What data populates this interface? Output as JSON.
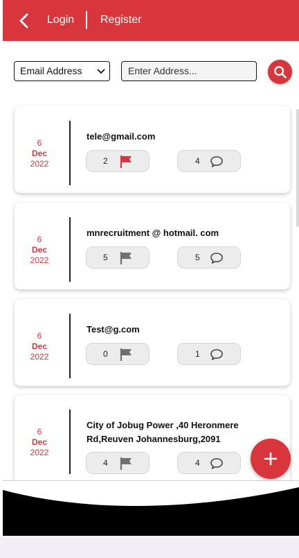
{
  "header": {
    "back_icon": "chevron-left-icon",
    "login_label": "Login",
    "register_label": "Register",
    "color": "#d8363c"
  },
  "search": {
    "filter_selected": "Email Address",
    "address_placeholder": "Enter Address...",
    "search_icon": "search-icon"
  },
  "cards": [
    {
      "day": "6",
      "month": "Dec",
      "year": "2022",
      "title": "tele@gmail.com",
      "flags": "2",
      "flag_active": true,
      "comments": "4"
    },
    {
      "day": "6",
      "month": "Dec",
      "year": "2022",
      "title": "mnrecruitment @ hotmail. com",
      "flags": "5",
      "flag_active": false,
      "comments": "5"
    },
    {
      "day": "6",
      "month": "Dec",
      "year": "2022",
      "title": "Test@g.com",
      "flags": "0",
      "flag_active": false,
      "comments": "1"
    },
    {
      "day": "6",
      "month": "Dec",
      "year": "2022",
      "title": "City of Jobug Power ,40 Heronmere Rd,Reuven Johannesburg,2091",
      "flags": "4",
      "flag_active": false,
      "comments": "4"
    }
  ],
  "fab": {
    "icon": "plus-icon"
  },
  "colors": {
    "accent": "#d8363c",
    "flag_active": "#d8363c",
    "flag_inactive": "#6f6f6f"
  }
}
